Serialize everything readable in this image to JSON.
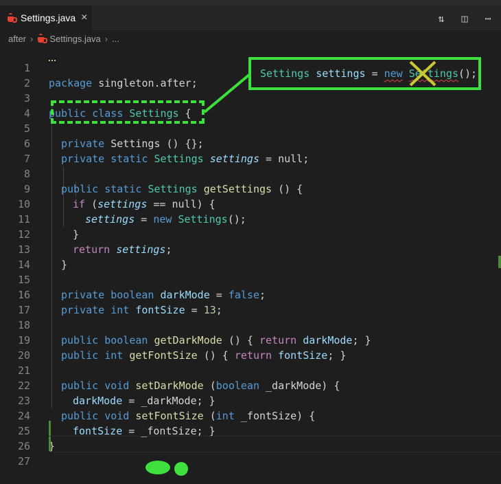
{
  "tab": {
    "file_name": "Settings.java",
    "close_glyph": "×"
  },
  "tab_actions": [
    {
      "icon": "compare-changes-icon",
      "glyph": "⇅"
    },
    {
      "icon": "split-editor-icon",
      "glyph": "◫"
    },
    {
      "icon": "more-actions-icon",
      "glyph": "⋯"
    }
  ],
  "breadcrumb": {
    "folder": "after",
    "file": "Settings.java",
    "symbol": "..."
  },
  "callout": {
    "type": "Settings",
    "var": "settings",
    "op": "=",
    "kw": "new",
    "ctor": "Settings",
    "tail": "();"
  },
  "lines": {
    "l1": {
      "num": "1",
      "package_kw": "package",
      "rest": " singleton.after;"
    },
    "l2": {
      "num": "2"
    },
    "l3": {
      "num": "3",
      "kw1": "public",
      "kw2": "class",
      "type": "Settings",
      "rest": " {"
    },
    "l4": {
      "num": "4"
    },
    "l5": {
      "num": "5",
      "kw1": "private",
      "rest": " Settings () {};"
    },
    "l6": {
      "num": "6",
      "kw1": "private",
      "kw2": "static",
      "type": "Settings",
      "var": "settings",
      "rest": " = null;"
    },
    "l7": {
      "num": "7"
    },
    "l8": {
      "num": "8",
      "kw1": "public",
      "kw2": "static",
      "type": "Settings",
      "fn": "getSettings",
      "rest": " () {"
    },
    "l9": {
      "num": "9",
      "kw": "if",
      "a": " (",
      "var": "settings",
      "rest": " == null) {"
    },
    "l10": {
      "num": "10",
      "var": "settings",
      "a": " = ",
      "kw": "new",
      "type": "Settings",
      "rest": "();"
    },
    "l11": {
      "num": "11",
      "rest": "}"
    },
    "l12": {
      "num": "12",
      "kw": "return",
      "var": "settings",
      "rest": ";"
    },
    "l13": {
      "num": "13",
      "rest": "}"
    },
    "l14": {
      "num": "14"
    },
    "l15": {
      "num": "15",
      "kw1": "private",
      "kw2": "boolean",
      "var": "darkMode",
      "a": " = ",
      "val": "false",
      "rest": ";"
    },
    "l16": {
      "num": "16",
      "kw1": "private",
      "kw2": "int",
      "var": "fontSize",
      "a": " = ",
      "val": "13",
      "rest": ";"
    },
    "l17": {
      "num": "17"
    },
    "l18": {
      "num": "18",
      "kw1": "public",
      "kw2": "boolean",
      "fn": "getDarkMode",
      "a": " () { ",
      "ret": "return",
      "var": "darkMode",
      "rest": "; }"
    },
    "l19": {
      "num": "19",
      "kw1": "public",
      "kw2": "int",
      "fn": "getFontSize",
      "a": " () { ",
      "ret": "return",
      "var": "fontSize",
      "rest": "; }"
    },
    "l20": {
      "num": "20"
    },
    "l21": {
      "num": "21",
      "kw1": "public",
      "kw2": "void",
      "fn": "setDarkMode",
      "a": " (",
      "kw3": "boolean",
      "rest": " _darkMode) {"
    },
    "l22": {
      "num": "22",
      "var": "darkMode",
      "rest": " = _darkMode; }"
    },
    "l23": {
      "num": "23",
      "kw1": "public",
      "kw2": "void",
      "fn": "setFontSize",
      "a": " (",
      "kw3": "int",
      "rest": " _fontSize) {"
    },
    "l24": {
      "num": "24",
      "var": "fontSize",
      "rest": " = _fontSize; }"
    },
    "l25": {
      "num": "25",
      "rest": "}"
    },
    "l26": {
      "num": "26"
    },
    "l27": {
      "num": "27"
    }
  }
}
